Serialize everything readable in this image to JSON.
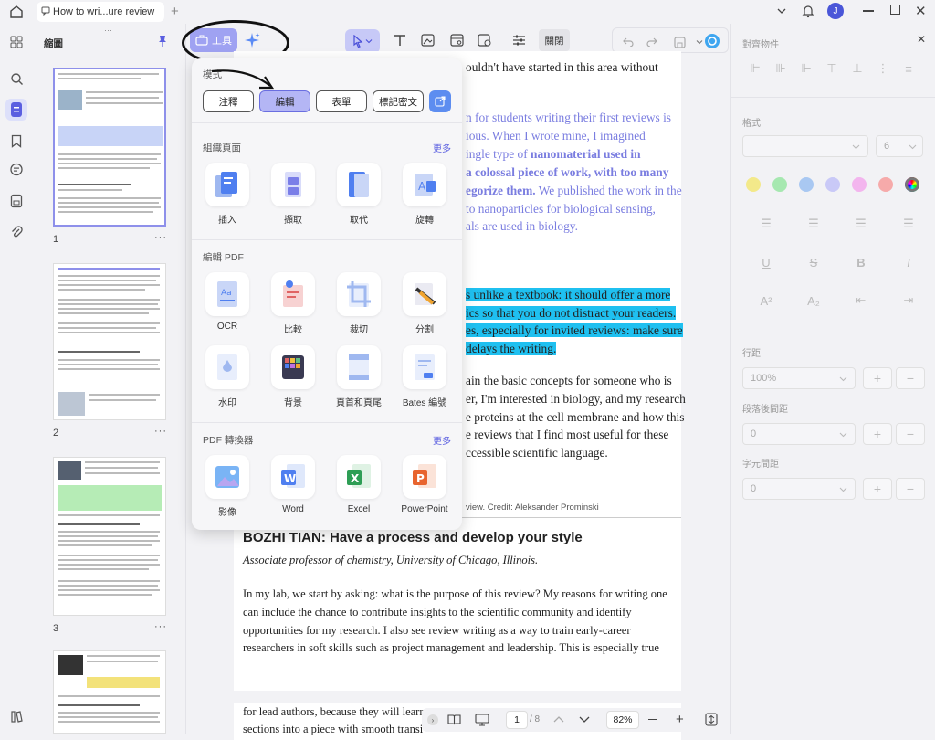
{
  "tab": {
    "title": "How to wri...ure review"
  },
  "user": {
    "avatar_initial": "J"
  },
  "thumbs": {
    "title": "縮圖",
    "pages": [
      "1",
      "2",
      "3"
    ],
    "more": "···"
  },
  "toolbar": {
    "tools_label": "工具",
    "close_label": "關閉"
  },
  "popup": {
    "mode_title": "模式",
    "modes": [
      "注釋",
      "編輯",
      "表單",
      "標記密文"
    ],
    "organize_title": "組織頁面",
    "organize_more": "更多",
    "organize": [
      "插入",
      "擷取",
      "取代",
      "旋轉"
    ],
    "edit_title": "編輯 PDF",
    "edit": [
      "OCR",
      "比較",
      "裁切",
      "分割",
      "水印",
      "背景",
      "頁首和頁尾",
      "Bates 編號"
    ],
    "convert_title": "PDF 轉換器",
    "convert_more": "更多",
    "convert": [
      "影像",
      "Word",
      "Excel",
      "PowerPoint"
    ]
  },
  "doc": {
    "l1": "ouldn't have started in this area without",
    "p1": [
      "n for students writing their first reviews is",
      "ious. When I wrote mine, I imagined",
      "ingle type of ",
      "a colossal piece of work, with too many",
      "egorize them.",
      " We  published the work in the",
      "to nanoparticles for biological sensing,",
      "als are used in biology."
    ],
    "p1_bold1": "nanomaterial used in",
    "p2": [
      "s unlike a textbook: it should offer a more",
      "ics so that you do not distract your readers.",
      "es, especially for invited reviews: make sure",
      "delays the writing."
    ],
    "p3": [
      "ain the basic concepts for someone who is",
      "er, I'm interested in biology, and my research",
      "e proteins at the cell membrane and how this",
      "e reviews that I find most useful for these",
      "ccessible scientific language."
    ],
    "caption": "view.  Credit: Aleksander Prominski",
    "heading": "BOZHI TIAN: Have a process and develop your style",
    "subheading": "Associate professor of chemistry, University of Chicago, Illinois.",
    "p4": [
      "In my lab, we start by asking: what is the purpose of this review? My reasons for writing one",
      "can include the chance to contribute insights to the scientific community and identify",
      "opportunities for my research. I also see review writing as a way to train early-career",
      "researchers in soft skills such as project management and leadership. This is especially true"
    ],
    "p5": [
      "for lead authors, because they will learr",
      "sections into a piece with smooth transi"
    ]
  },
  "right": {
    "align_title": "對齊物件",
    "format_title": "格式",
    "font_size": "6",
    "line_spacing_title": "行距",
    "line_spacing": "100%",
    "para_spacing_title": "段落後間距",
    "para_spacing": "0",
    "char_spacing_title": "字元間距",
    "char_spacing": "0",
    "swatches": [
      "#f3e98a",
      "#a6e8b0",
      "#a9c8f2",
      "#c9c9f7",
      "#f3b5ee",
      "#f6aaaa",
      "#777777"
    ]
  },
  "bottom": {
    "page_current": "1",
    "page_total": "/ 8",
    "zoom": "82%"
  }
}
